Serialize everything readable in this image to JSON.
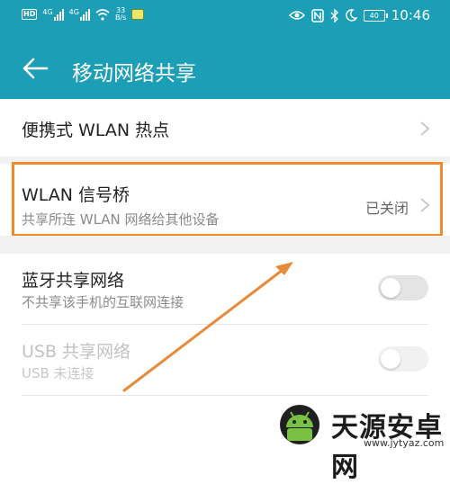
{
  "status_bar": {
    "left": {
      "badge": "HD",
      "sim1": "4G",
      "sim2": "4G",
      "speed_value": "33",
      "speed_unit": "B/s"
    },
    "icons": [
      "eye-icon",
      "nfc-icon",
      "bluetooth-icon",
      "moon-icon"
    ],
    "battery": "40",
    "time": "10:46"
  },
  "header": {
    "title": "移动网络共享",
    "back_icon": "arrow-left-icon"
  },
  "rows": {
    "hotspot": {
      "title": "便携式 WLAN 热点"
    },
    "bridge": {
      "title": "WLAN 信号桥",
      "subtitle": "共享所连 WLAN 网络给其他设备",
      "value": "已关闭"
    },
    "bluetooth": {
      "title": "蓝牙共享网络",
      "subtitle": "不共享该手机的互联网连接",
      "enabled": false
    },
    "usb": {
      "title": "USB 共享网络",
      "subtitle": "USB 未连接",
      "enabled": false,
      "disabled": true
    }
  },
  "watermark": {
    "text": "天源安卓网",
    "url": "www.jytyaz.com"
  },
  "colors": {
    "appbar": "#1c9fb6",
    "highlight": "#f08a2b",
    "arrow": "#e88a3a"
  }
}
